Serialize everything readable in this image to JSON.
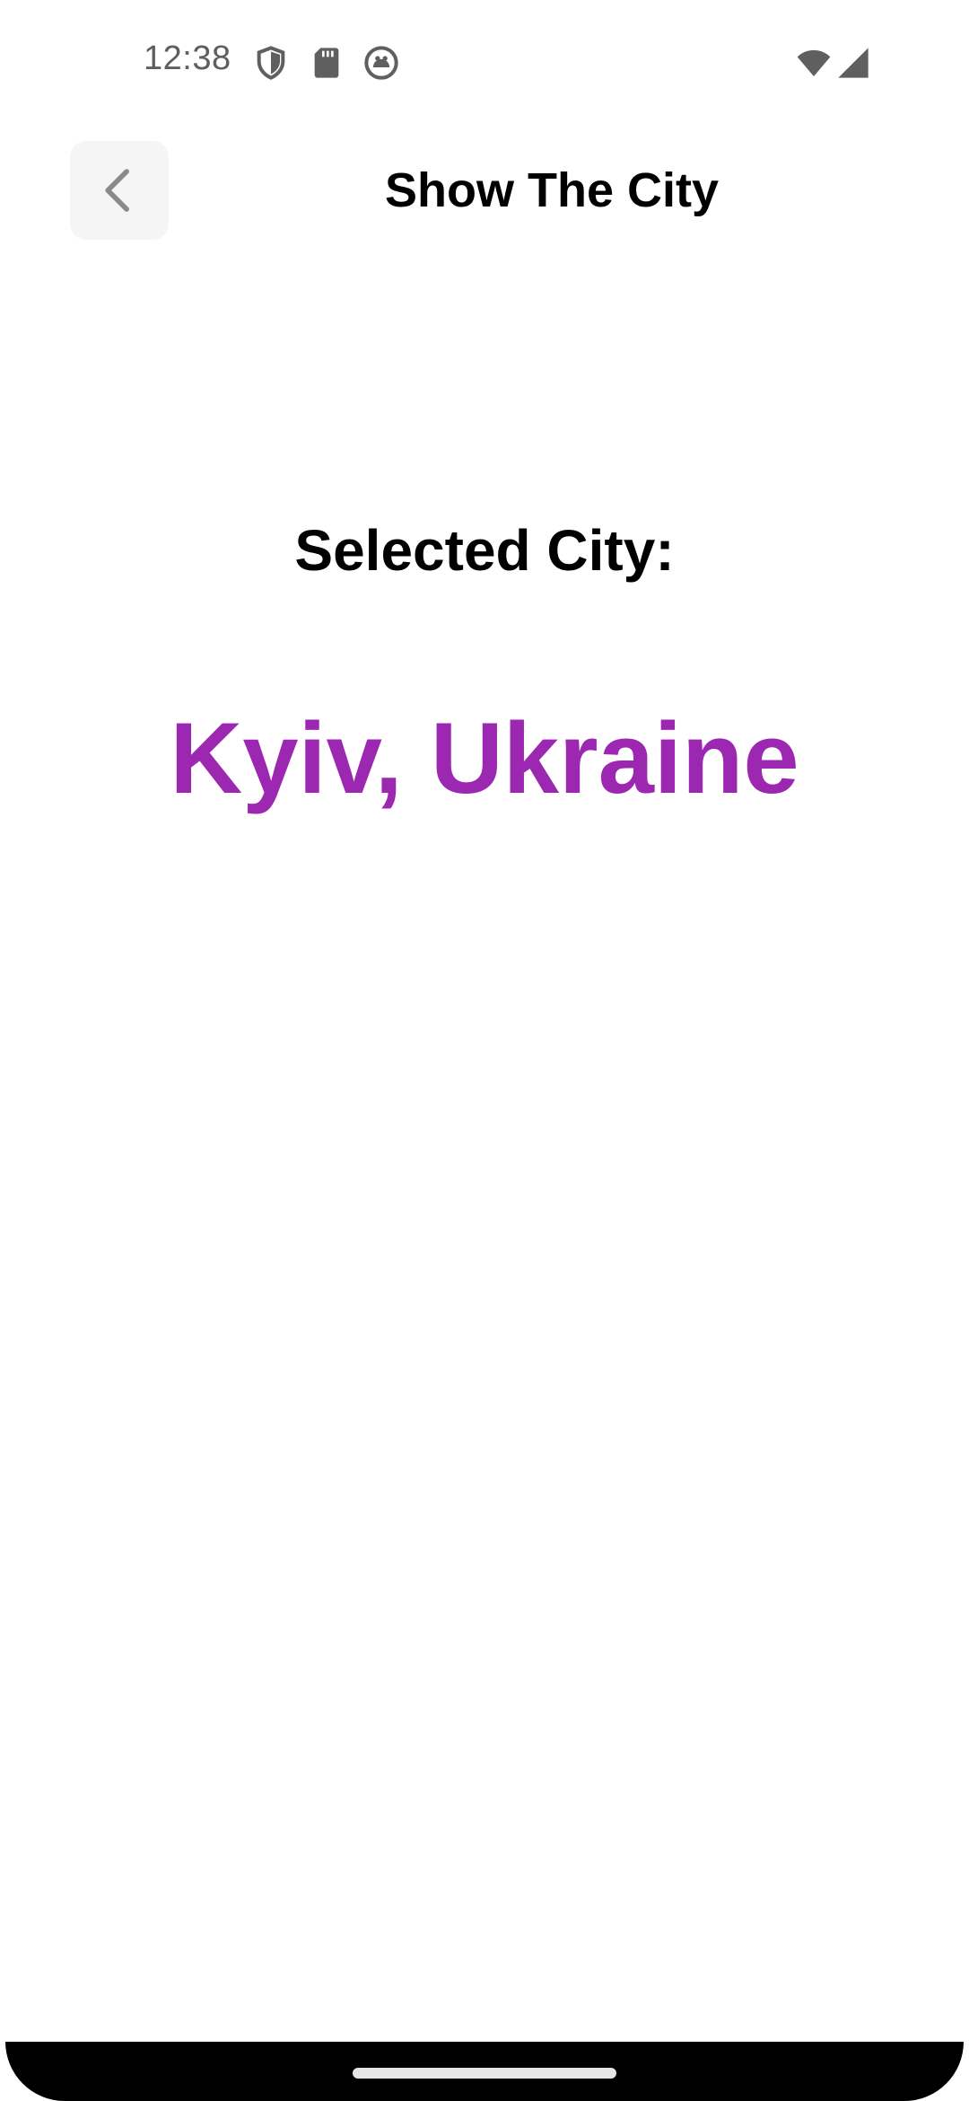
{
  "status_bar": {
    "time": "12:38",
    "icons": [
      "shield-icon",
      "sd-card-icon",
      "android-face-icon",
      "wifi-icon",
      "cellular-signal-icon"
    ]
  },
  "app_bar": {
    "back_icon": "chevron-left-icon",
    "title": "Show The City"
  },
  "content": {
    "label": "Selected City:",
    "city": "Kyiv, Ukraine"
  },
  "colors": {
    "accent": "#9c27b0",
    "back_button_bg": "#f5f5f5",
    "status_icon": "#5f5f5f",
    "nav_bar": "#000000"
  }
}
